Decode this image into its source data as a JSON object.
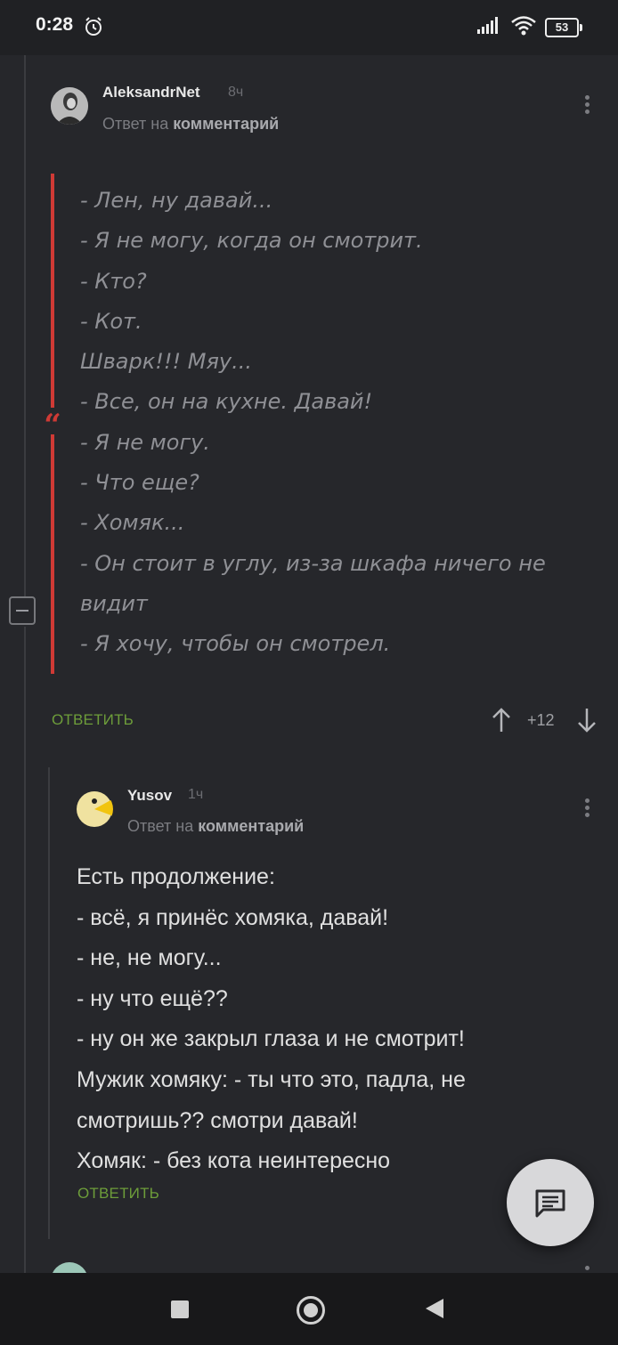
{
  "status_bar": {
    "time": "0:28",
    "battery": "53"
  },
  "comment1": {
    "username": "AleksandrNet",
    "time_ago": "8ч",
    "reply_prefix": "Ответ на",
    "reply_target": "комментарий",
    "quote_lines": [
      "- Лен, ну давай...",
      "- Я не могу, когда он смотрит.",
      "- Кто?",
      "- Кот.",
      "Шварк!!! Мяу...",
      "- Все, он на кухне. Давай!",
      "- Я не могу.",
      "- Что еще?",
      "- Хомяк...",
      "- Он стоит в углу, из-за шкафа ничего не",
      "видит",
      "- Я хочу, чтобы он смотрел."
    ],
    "reply_label": "ОТВЕТИТЬ",
    "rating": "+12"
  },
  "comment2": {
    "username": "Yusov",
    "time_ago": "1ч",
    "reply_prefix": "Ответ на",
    "reply_target": "комментарий",
    "lines": [
      "Есть продолжение:",
      "- всё, я принёс хомяка, давай!",
      "- не, не могу...",
      "- ну что ещё??",
      "- ну он же закрыл глаза и не смотрит!",
      "Мужик хомяку:  - ты что это, падла, не",
      "смотришь?? смотри давай!",
      "Хомяк:  - без кота неинтересно"
    ],
    "reply_label": "ОТВЕТИТЬ"
  },
  "colors": {
    "background": "#26272b",
    "quote_accent": "#cf3a35",
    "reply_link": "#6d9d3a"
  },
  "icons": [
    "alarm-icon",
    "signal-icon",
    "wifi-icon",
    "battery-icon",
    "collapse-icon",
    "arrow-up-icon",
    "arrow-down-icon",
    "comment-fab-icon",
    "nav-recents-icon",
    "nav-home-icon",
    "nav-back-icon"
  ]
}
